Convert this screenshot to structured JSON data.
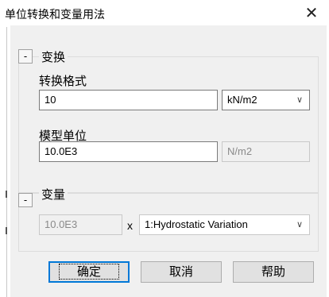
{
  "window": {
    "title": "单位转换和变量用法"
  },
  "icons": {
    "close": "close-icon",
    "dropdown": "chevron-down-icon"
  },
  "conversion_group": {
    "collapse_label": "-",
    "title": "变换",
    "format_label": "转换格式",
    "format_value": "10",
    "format_unit": "kN/m2",
    "model_unit_label": "模型单位",
    "model_unit_value": "10.0E3",
    "model_unit_unit": "N/m2"
  },
  "variable_group": {
    "collapse_label": "-",
    "title": "变量",
    "value": "10.0E3",
    "multiply": "x",
    "variation": "1:Hydrostatic Variation"
  },
  "buttons": {
    "ok": "确定",
    "cancel": "取消",
    "help": "帮助"
  },
  "colors": {
    "accent": "#0078d7",
    "panel_bg": "#f0f0f0"
  }
}
